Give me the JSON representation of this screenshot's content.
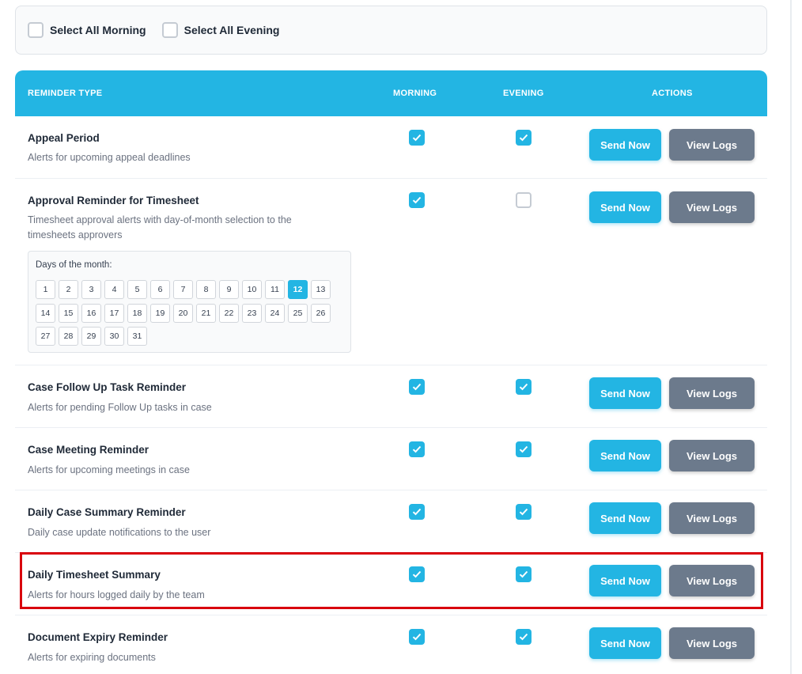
{
  "select_all": {
    "morning_label": "Select All Morning",
    "evening_label": "Select All Evening"
  },
  "table": {
    "headers": {
      "type": "REMINDER TYPE",
      "morning": "MORNING",
      "evening": "EVENING",
      "actions": "ACTIONS"
    },
    "send_label": "Send Now",
    "logs_label": "View Logs",
    "days_label": "Days of the month:",
    "days": [
      "1",
      "2",
      "3",
      "4",
      "5",
      "6",
      "7",
      "8",
      "9",
      "10",
      "11",
      "12",
      "13",
      "14",
      "15",
      "16",
      "17",
      "18",
      "19",
      "20",
      "21",
      "22",
      "23",
      "24",
      "25",
      "26",
      "27",
      "28",
      "29",
      "30",
      "31"
    ],
    "selected_day": "12",
    "rows": [
      {
        "title": "Appeal Period",
        "desc": "Alerts for upcoming appeal deadlines",
        "morning": true,
        "evening": true
      },
      {
        "title": "Approval Reminder for Timesheet",
        "desc": "Timesheet approval alerts with day-of-month selection to the timesheets approvers",
        "morning": true,
        "evening": false
      },
      {
        "title": "Case Follow Up Task Reminder",
        "desc": "Alerts for pending Follow Up tasks in case",
        "morning": true,
        "evening": true
      },
      {
        "title": "Case Meeting Reminder",
        "desc": "Alerts for upcoming meetings in case",
        "morning": true,
        "evening": true
      },
      {
        "title": "Daily Case Summary Reminder",
        "desc": "Daily case update notifications to the user",
        "morning": true,
        "evening": true
      },
      {
        "title": "Daily Timesheet Summary",
        "desc": "Alerts for hours logged daily by the team",
        "morning": true,
        "evening": true
      },
      {
        "title": "Document Expiry Reminder",
        "desc": "Alerts for expiring documents",
        "morning": true,
        "evening": true
      }
    ]
  },
  "colors": {
    "accent": "#23b5e3",
    "logs_button": "#6c7a8c",
    "highlight": "#d9000d"
  },
  "icons": {
    "checked": "check-icon"
  }
}
